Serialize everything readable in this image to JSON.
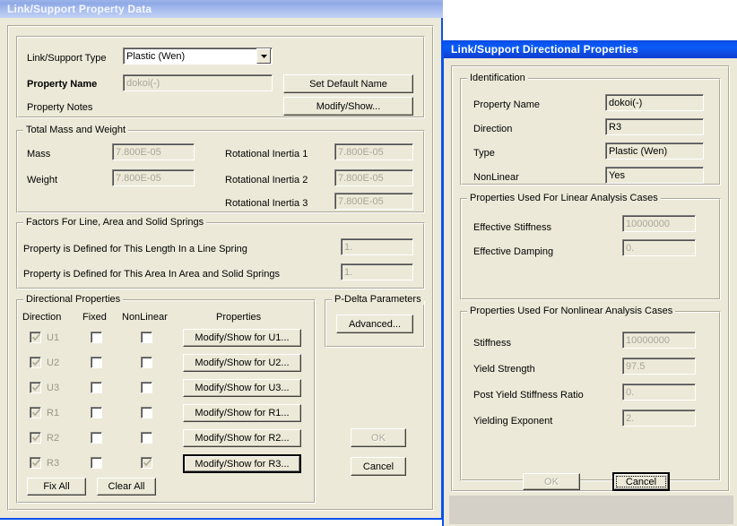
{
  "left_dialog": {
    "title": "Link/Support Property Data",
    "link_support_type": {
      "label": "Link/Support Type",
      "value": "Plastic (Wen)"
    },
    "property_name": {
      "label": "Property Name",
      "value": "dokoi(-)"
    },
    "property_notes_label": "Property Notes",
    "set_default_name_button": "Set Default Name",
    "modify_show_button": "Modify/Show...",
    "total_mass_weight": {
      "title": "Total Mass and Weight",
      "rows": [
        {
          "label": "Mass",
          "value": "7.800E-05"
        },
        {
          "label": "Weight",
          "value": "7.800E-05"
        }
      ],
      "inertia": [
        {
          "label": "Rotational Inertia 1",
          "value": "7.800E-05"
        },
        {
          "label": "Rotational Inertia 2",
          "value": "7.800E-05"
        },
        {
          "label": "Rotational Inertia 3",
          "value": "7.800E-05"
        }
      ]
    },
    "factors": {
      "title": "Factors For Line, Area and Solid Springs",
      "rows": [
        {
          "label": "Property is Defined for This Length In a Line Spring",
          "value": "1."
        },
        {
          "label": "Property is Defined for This Area In Area and Solid Springs",
          "value": "1."
        }
      ]
    },
    "directional_properties": {
      "title": "Directional Properties",
      "columns": [
        "Direction",
        "Fixed",
        "NonLinear",
        "Properties"
      ],
      "rows": [
        {
          "direction": "U1",
          "direction_checked": true,
          "fixed_checked": false,
          "nonlinear_checked": false,
          "button": "Modify/Show for U1..."
        },
        {
          "direction": "U2",
          "direction_checked": true,
          "fixed_checked": false,
          "nonlinear_checked": false,
          "button": "Modify/Show for U2..."
        },
        {
          "direction": "U3",
          "direction_checked": true,
          "fixed_checked": false,
          "nonlinear_checked": false,
          "button": "Modify/Show for U3..."
        },
        {
          "direction": "R1",
          "direction_checked": true,
          "fixed_checked": false,
          "nonlinear_checked": false,
          "button": "Modify/Show for R1..."
        },
        {
          "direction": "R2",
          "direction_checked": true,
          "fixed_checked": false,
          "nonlinear_checked": false,
          "button": "Modify/Show for R2..."
        },
        {
          "direction": "R3",
          "direction_checked": true,
          "fixed_checked": false,
          "nonlinear_checked": true,
          "button": "Modify/Show for R3..."
        }
      ],
      "fix_all_button": "Fix All",
      "clear_all_button": "Clear All"
    },
    "pdelta": {
      "title": "P-Delta Parameters",
      "advanced_button": "Advanced..."
    },
    "ok_button": "OK",
    "cancel_button": "Cancel"
  },
  "right_dialog": {
    "title": "Link/Support Directional Properties",
    "identification": {
      "title": "Identification",
      "rows": [
        {
          "label": "Property Name",
          "value": "dokoi(-)"
        },
        {
          "label": "Direction",
          "value": "R3"
        },
        {
          "label": "Type",
          "value": "Plastic (Wen)"
        },
        {
          "label": "NonLinear",
          "value": "Yes"
        }
      ]
    },
    "linear": {
      "title": "Properties Used For Linear Analysis Cases",
      "rows": [
        {
          "label": "Effective Stiffness",
          "value": "10000000"
        },
        {
          "label": "Effective Damping",
          "value": "0."
        }
      ]
    },
    "nonlinear": {
      "title": "Properties Used For Nonlinear Analysis Cases",
      "rows": [
        {
          "label": "Stiffness",
          "value": "10000000"
        },
        {
          "label": "Yield Strength",
          "value": "97.5"
        },
        {
          "label": "Post Yield Stiffness Ratio",
          "value": "0."
        },
        {
          "label": "Yielding Exponent",
          "value": "2."
        }
      ]
    },
    "ok_button": "OK",
    "cancel_button": "Cancel"
  },
  "colors": {
    "dialog_face": "#ece9d8",
    "titlebar_active": "#0a52ee",
    "titlebar_inactive": "#a8bdee",
    "disabled_text": "#aca899",
    "status_strip": "#d4d0c8"
  }
}
